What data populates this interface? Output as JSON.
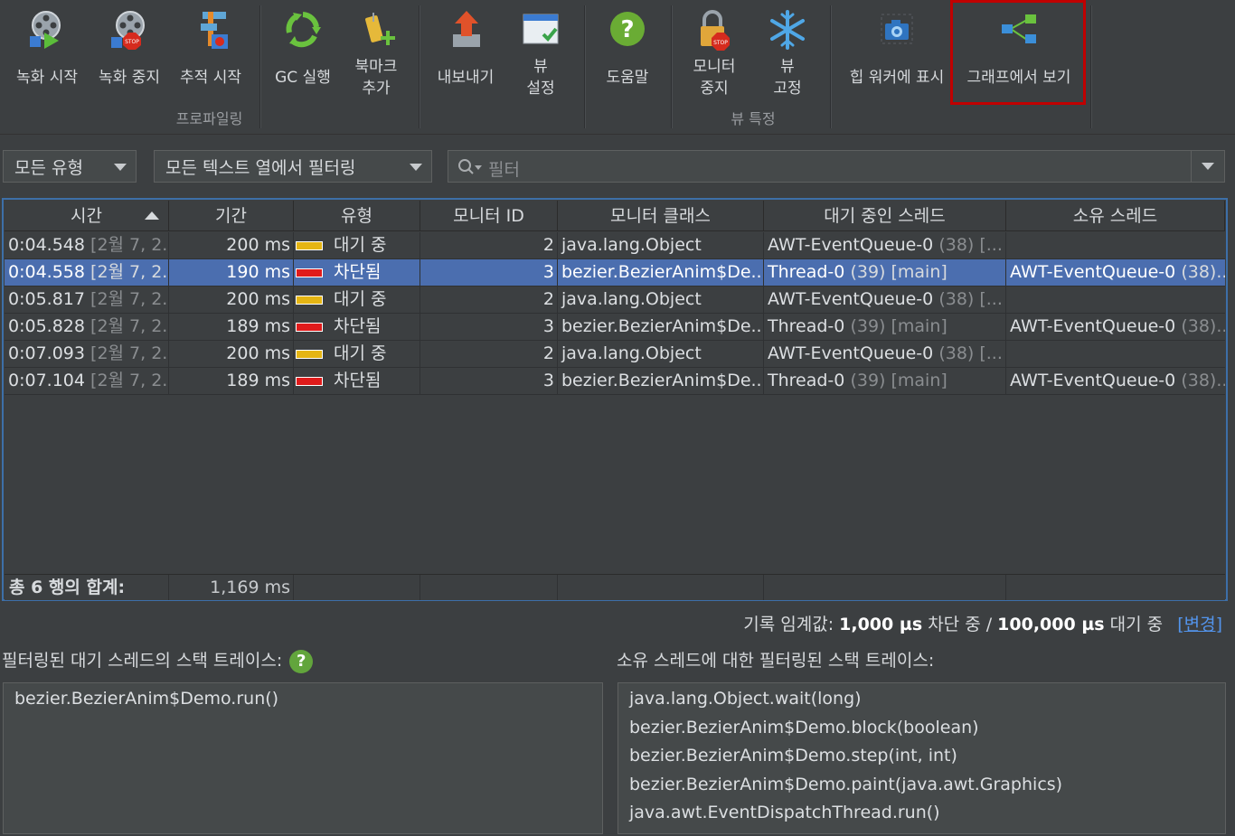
{
  "toolbar": {
    "buttons": [
      {
        "label": "녹화 시작",
        "icon": "film-reel-play-icon"
      },
      {
        "label": "녹화 중지",
        "icon": "film-reel-stop-icon"
      },
      {
        "label": "추적 시작",
        "icon": "trace-start-icon"
      },
      {
        "label": "GC 실행",
        "icon": "recycle-icon"
      },
      {
        "label": "북마크\n추가",
        "icon": "bookmark-add-icon"
      },
      {
        "label": "내보내기",
        "icon": "export-icon"
      },
      {
        "label": "뷰\n설정",
        "icon": "view-settings-icon"
      },
      {
        "label": "도움말",
        "icon": "help-icon"
      },
      {
        "label": "모니터\n중지",
        "icon": "lock-stop-icon"
      },
      {
        "label": "뷰\n고정",
        "icon": "snowflake-icon"
      },
      {
        "label": "힙 워커에 표시",
        "icon": "camera-icon"
      },
      {
        "label": "그래프에서 보기",
        "icon": "graph-icon"
      }
    ],
    "groups": {
      "profiling": "프로파일링",
      "view_specific": "뷰 특정"
    },
    "colors": {
      "highlight": "#c00000"
    }
  },
  "filters": {
    "type_combo": "모든 유형",
    "column_combo": "모든 텍스트 열에서 필터링",
    "search_placeholder": "필터"
  },
  "table": {
    "columns": [
      "시간",
      "기간",
      "유형",
      "모니터 ID",
      "모니터 클래스",
      "대기 중인 스레드",
      "소유 스레드"
    ],
    "rows": [
      {
        "time": "0:04.548",
        "date": "[2월 7, 2...",
        "duration": "200 ms",
        "type": "대기 중",
        "type_color": "#e5b513",
        "monitor_id": "2",
        "monitor_class": "java.lang.Object",
        "waiting": "AWT-EventQueue-0",
        "waiting_detail": "(38) [...",
        "owning": "",
        "owning_detail": "",
        "selected": false
      },
      {
        "time": "0:04.558",
        "date": "[2월 7, 2...",
        "duration": "190 ms",
        "type": "차단됨",
        "type_color": "#e01b1b",
        "monitor_id": "3",
        "monitor_class": "bezier.BezierAnim$De...",
        "waiting": "Thread-0",
        "waiting_detail": "(39) [main]",
        "owning": "AWT-EventQueue-0",
        "owning_detail": "(38)...",
        "selected": true
      },
      {
        "time": "0:05.817",
        "date": "[2월 7, 2...",
        "duration": "200 ms",
        "type": "대기 중",
        "type_color": "#e5b513",
        "monitor_id": "2",
        "monitor_class": "java.lang.Object",
        "waiting": "AWT-EventQueue-0",
        "waiting_detail": "(38) [...",
        "owning": "",
        "owning_detail": "",
        "selected": false
      },
      {
        "time": "0:05.828",
        "date": "[2월 7, 2...",
        "duration": "189 ms",
        "type": "차단됨",
        "type_color": "#e01b1b",
        "monitor_id": "3",
        "monitor_class": "bezier.BezierAnim$De...",
        "waiting": "Thread-0",
        "waiting_detail": "(39) [main]",
        "owning": "AWT-EventQueue-0",
        "owning_detail": "(38)...",
        "selected": false
      },
      {
        "time": "0:07.093",
        "date": "[2월 7, 2...",
        "duration": "200 ms",
        "type": "대기 중",
        "type_color": "#e5b513",
        "monitor_id": "2",
        "monitor_class": "java.lang.Object",
        "waiting": "AWT-EventQueue-0",
        "waiting_detail": "(38) [...",
        "owning": "",
        "owning_detail": "",
        "selected": false
      },
      {
        "time": "0:07.104",
        "date": "[2월 7, 2...",
        "duration": "189 ms",
        "type": "차단됨",
        "type_color": "#e01b1b",
        "monitor_id": "3",
        "monitor_class": "bezier.BezierAnim$De...",
        "waiting": "Thread-0",
        "waiting_detail": "(39) [main]",
        "owning": "AWT-EventQueue-0",
        "owning_detail": "(38)...",
        "selected": false
      }
    ],
    "footer": {
      "label": "총 6 행의 합계:",
      "total": "1,169 ms"
    }
  },
  "threshold": {
    "prefix": "기록 임계값:",
    "blocked_value": "1,000 µs",
    "blocked_text": "차단 중 /",
    "waiting_value": "100,000 µs",
    "waiting_text": "대기 중",
    "change_link": "[변경]"
  },
  "stack_waiting": {
    "title": "필터링된 대기 스레드의 스택 트레이스:",
    "help": "?",
    "lines": [
      "bezier.BezierAnim$Demo.run()"
    ]
  },
  "stack_owning": {
    "title": "소유 스레드에 대한 필터링된 스택 트레이스:",
    "lines": [
      "java.lang.Object.wait(long)",
      "bezier.BezierAnim$Demo.block(boolean)",
      "bezier.BezierAnim$Demo.step(int, int)",
      "bezier.BezierAnim$Demo.paint(java.awt.Graphics)",
      "java.awt.EventDispatchThread.run()"
    ]
  }
}
